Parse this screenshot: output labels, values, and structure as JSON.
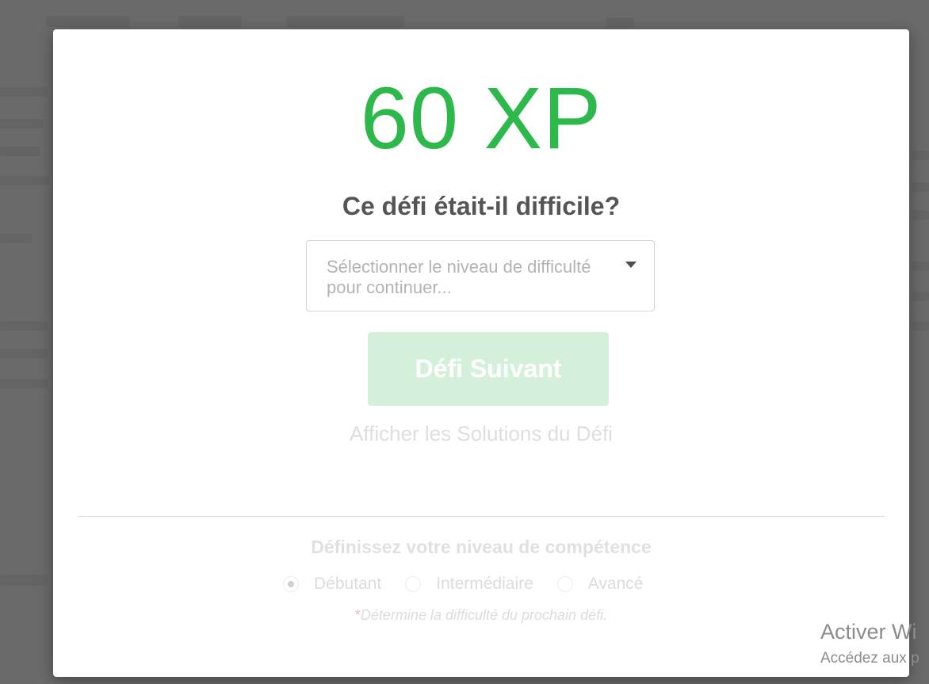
{
  "modal": {
    "xp": "60 XP",
    "question": "Ce défi était-il difficile?",
    "difficulty_select": {
      "placeholder": "Sélectionner le niveau de difficulté pour continuer..."
    },
    "next_button": "Défi Suivant",
    "solutions_link": "Afficher les Solutions du Défi",
    "skill_section": {
      "title": "Définissez votre niveau de compétence",
      "options": [
        {
          "label": "Débutant",
          "selected": true
        },
        {
          "label": "Intermédiaire",
          "selected": false
        },
        {
          "label": "Avancé",
          "selected": false
        }
      ],
      "note_star": "*",
      "note": "Détermine la difficulté du prochain défi."
    }
  },
  "windows_watermark": {
    "line1": "Activer Wi",
    "line2": "Accédez aux p"
  },
  "colors": {
    "xp_green": "#2db84c",
    "button_disabled": "#d4f0da",
    "overlay": "#6a6a6a"
  }
}
